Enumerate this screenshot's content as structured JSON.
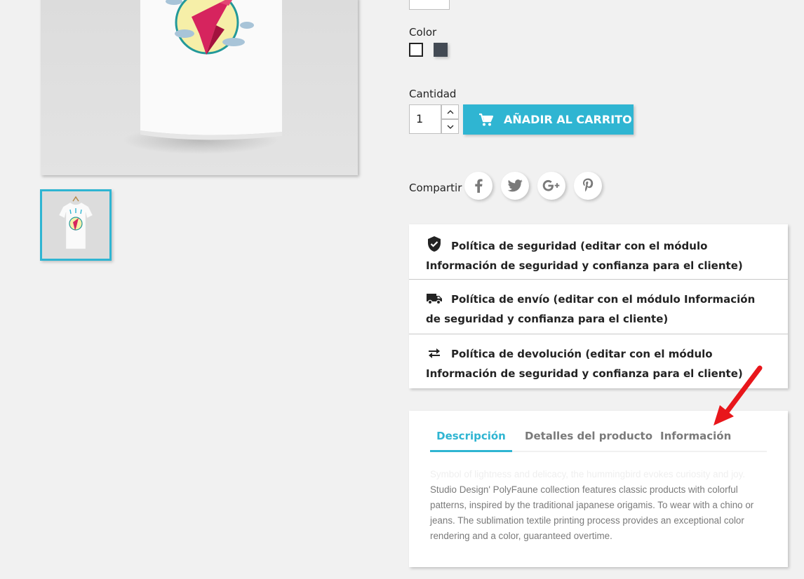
{
  "colors": {
    "accent": "#2fb5d2",
    "background": "#f1f1f1",
    "swatch_dark": "#434a54",
    "arrow": "#e8161b"
  },
  "product": {
    "color_label": "Color",
    "color_options": [
      {
        "name": "white",
        "hex": "#ffffff",
        "selected": true
      },
      {
        "name": "dark-grey",
        "hex": "#434a54",
        "selected": false
      }
    ],
    "quantity_label": "Cantidad",
    "quantity_value": "1",
    "add_to_cart_label": "AÑADIR AL CARRITO"
  },
  "share": {
    "label": "Compartir",
    "networks": [
      "facebook-icon",
      "twitter-icon",
      "googleplus-icon",
      "pinterest-icon"
    ]
  },
  "reassurance": {
    "items": [
      {
        "icon": "shield-check-icon",
        "text": "Política de seguridad (editar con el módulo Información de seguridad y confianza para el cliente)"
      },
      {
        "icon": "truck-icon",
        "text": "Política de envío (editar con el módulo Información de seguridad y confianza para el cliente)"
      },
      {
        "icon": "swap-arrows-icon",
        "text": "Política de devolución (editar con el módulo Información de seguridad y confianza para el cliente)"
      }
    ]
  },
  "tabs": {
    "items": [
      {
        "label": "Descripción",
        "active": true
      },
      {
        "label": "Detalles del producto",
        "active": false
      },
      {
        "label": "Información",
        "active": false
      }
    ],
    "description_faded": "Symbol of lightness and delicacy, the hummingbird evokes curiosity and joy.",
    "description": "Studio Design' PolyFaune collection features classic products with colorful patterns, inspired by the traditional japanese origamis. To wear with a chino or jeans. The sublimation textile printing process provides an exceptional color rendering and a color, guaranteed overtime."
  }
}
